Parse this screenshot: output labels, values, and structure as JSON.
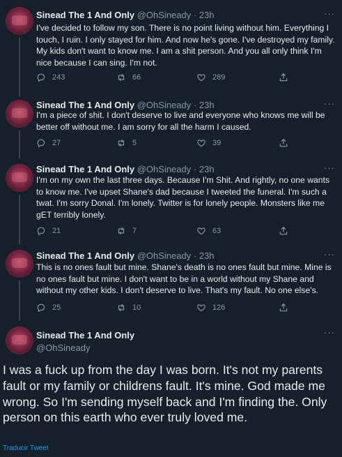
{
  "tweets": [
    {
      "name": "Sinead The 1 And Only",
      "handle": "@OhSineady",
      "time": "23h",
      "text": "I've decided to follow my son. There is no point living without him.  Everything I touch, I ruin.  I only stayed for him. And now he's gone. I've destroyed my family. My kids don't want to know me.  I am a shit person. And you all only think I'm nice because I can sing. I'm not.",
      "replies": "243",
      "retweets": "66",
      "likes": "289"
    },
    {
      "name": "Sinead The 1 And Only",
      "handle": "@OhSineady",
      "time": "23h",
      "text": "I'm a piece of shit. I don't deserve to live and everyone who knows me will be better off without me. I am sorry for all the harm I caused.",
      "replies": "27",
      "retweets": "5",
      "likes": "39"
    },
    {
      "name": "Sinead The 1 And Only",
      "handle": "@OhSineady",
      "time": "23h",
      "text": "I'm on my own the last three days. Because I'm Shit. And rightly, no one wants to know me. I've upset Shane's dad because I tweeted the funeral. I'm such a twat. I'm sorry Donal.  I'm lonely. Twitter is for lonely people.  Monsters like me gET terribly lonely.",
      "replies": "21",
      "retweets": "7",
      "likes": "63"
    },
    {
      "name": "Sinead The 1 And Only",
      "handle": "@OhSineady",
      "time": "23h",
      "text": "This is no ones fault but mine. Shane's death is no ones fault but mine. Mine is no ones fault but mine. I don't want to be in a world without my Shane and without my other kids. I don't deserve to live. That's my fault. No one else's.",
      "replies": "25",
      "retweets": "10",
      "likes": "126"
    }
  ],
  "main_tweet": {
    "name": "Sinead The 1 And Only",
    "handle": "@OhSineady",
    "text": "I was a fuck up from the day I was born. It's not my parents fault or my family or childrens  fault. It's mine. God made me wrong. So I'm sending myself back and I'm finding the. Only person on this earth who ever truly loved me.",
    "translate": "Traducir Tweet"
  },
  "meta": {
    "separator": "·",
    "more": "···"
  },
  "icons": [
    "reply-icon",
    "retweet-icon",
    "like-icon",
    "share-icon",
    "more-icon"
  ]
}
